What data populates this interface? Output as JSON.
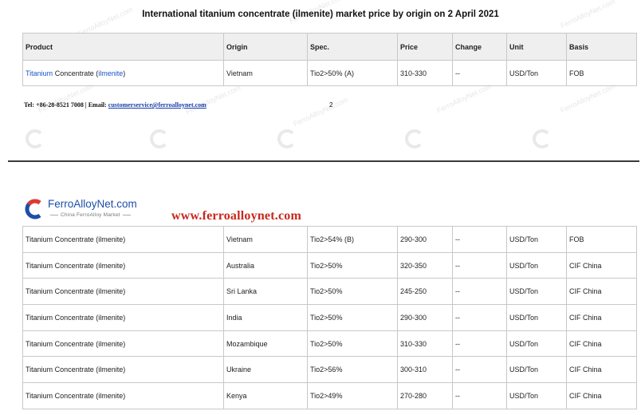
{
  "title": "International titanium concentrate (ilmenite) market price by origin on 2 April 2021",
  "table1": {
    "headers": [
      "Product",
      "Origin",
      "Spec.",
      "Price",
      "Change",
      "Unit",
      "Basis"
    ],
    "row": {
      "product_a": "Titanium",
      "product_b": " Concentrate (",
      "product_c": "ilmenite",
      "product_d": ")",
      "origin": "Vietnam",
      "spec": "Tio2>50% (A)",
      "price": "310-330",
      "change": "--",
      "unit": "USD/Ton",
      "basis": "FOB"
    }
  },
  "footer": {
    "contact": "Tel: +86-28-8521 7008 | Email: ",
    "email": "customerservice@ferroalloynet.com",
    "page": "2"
  },
  "logo": {
    "name": "FerroAlloyNet.com",
    "sub": "China FerroAlloy Market"
  },
  "site_url": "www.ferroalloynet.com",
  "watermark": "FerroAlloyNet.com",
  "table2": {
    "rows": [
      {
        "product": "Titanium Concentrate (ilmenite)",
        "origin": "Vietnam",
        "spec": "Tio2>54% (B)",
        "price": "290-300",
        "change": "--",
        "unit": "USD/Ton",
        "basis": "FOB"
      },
      {
        "product": "Titanium Concentrate (ilmenite)",
        "origin": "Australia",
        "spec": "Tio2>50%",
        "price": "320-350",
        "change": "--",
        "unit": "USD/Ton",
        "basis": "CIF China"
      },
      {
        "product": "Titanium Concentrate (ilmenite)",
        "origin": "Sri Lanka",
        "spec": "Tio2>50%",
        "price": "245-250",
        "change": "--",
        "unit": "USD/Ton",
        "basis": "CIF China"
      },
      {
        "product": "Titanium Concentrate (ilmenite)",
        "origin": "India",
        "spec": "Tio2>50%",
        "price": "290-300",
        "change": "--",
        "unit": "USD/Ton",
        "basis": "CIF China"
      },
      {
        "product": "Titanium Concentrate (ilmenite)",
        "origin": "Mozambique",
        "spec": "Tio2>50%",
        "price": "310-330",
        "change": "--",
        "unit": "USD/Ton",
        "basis": "CIF China"
      },
      {
        "product": "Titanium Concentrate (ilmenite)",
        "origin": "Ukraine",
        "spec": "Tio2>56%",
        "price": "300-310",
        "change": "--",
        "unit": "USD/Ton",
        "basis": "CIF China"
      },
      {
        "product": "Titanium Concentrate (ilmenite)",
        "origin": "Kenya",
        "spec": "Tio2>49%",
        "price": "270-280",
        "change": "--",
        "unit": "USD/Ton",
        "basis": "CIF China"
      }
    ]
  },
  "colors": {
    "logo_blue": "#1d4fa8",
    "site_red": "#c8281d",
    "link_blue": "#1a55c8"
  }
}
